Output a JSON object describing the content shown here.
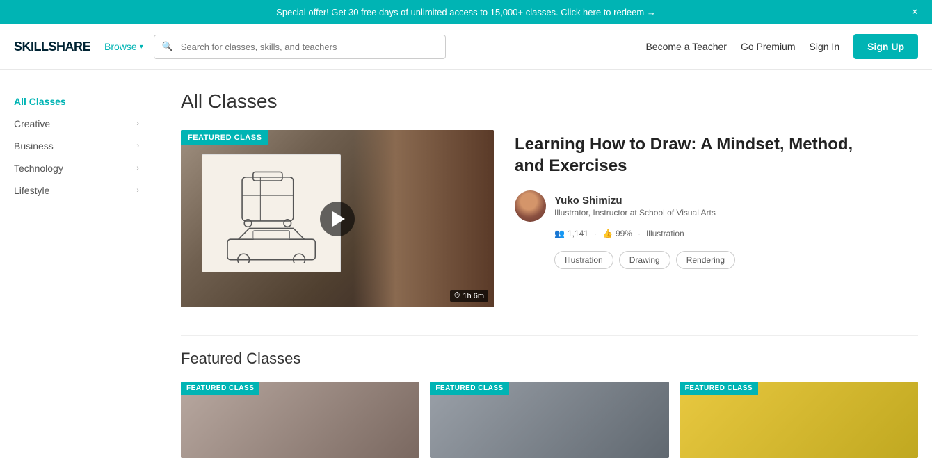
{
  "banner": {
    "text": "Special offer! Get 30 free days of unlimited access to 15,000+ classes. Click here to redeem →",
    "close": "×"
  },
  "header": {
    "logo": "SKILLSHARE",
    "browse_label": "Browse",
    "search_placeholder": "Search for classes, skills, and teachers",
    "become_teacher": "Become a Teacher",
    "go_premium": "Go Premium",
    "sign_in": "Sign In",
    "sign_up": "Sign Up"
  },
  "sidebar": {
    "items": [
      {
        "label": "All Classes",
        "active": true,
        "has_chevron": false
      },
      {
        "label": "Creative",
        "active": false,
        "has_chevron": true
      },
      {
        "label": "Business",
        "active": false,
        "has_chevron": true
      },
      {
        "label": "Technology",
        "active": false,
        "has_chevron": true
      },
      {
        "label": "Lifestyle",
        "active": false,
        "has_chevron": true
      }
    ]
  },
  "main": {
    "page_title": "All Classes",
    "featured_class": {
      "badge": "Featured Class",
      "title_line1": "Learning How to Draw: A Mindset, Method,",
      "title_line2": "and Exercises",
      "instructor_name": "Yuko Shimizu",
      "instructor_title": "Illustrator, Instructor at School of Visual Arts",
      "students": "1,141",
      "rating": "99%",
      "category": "Illustration",
      "duration": "1h 6m",
      "tags": [
        "Illustration",
        "Drawing",
        "Rendering"
      ]
    },
    "featured_section_title": "Featured Classes",
    "mini_cards": [
      {
        "badge": "Featured Class"
      },
      {
        "badge": "Featured Class"
      },
      {
        "badge": "Featured Class"
      }
    ]
  },
  "icons": {
    "search": "🔍",
    "chevron_right": "›",
    "chevron_down": "▾",
    "clock": "⏱",
    "students": "👥",
    "thumbsup": "👍"
  }
}
